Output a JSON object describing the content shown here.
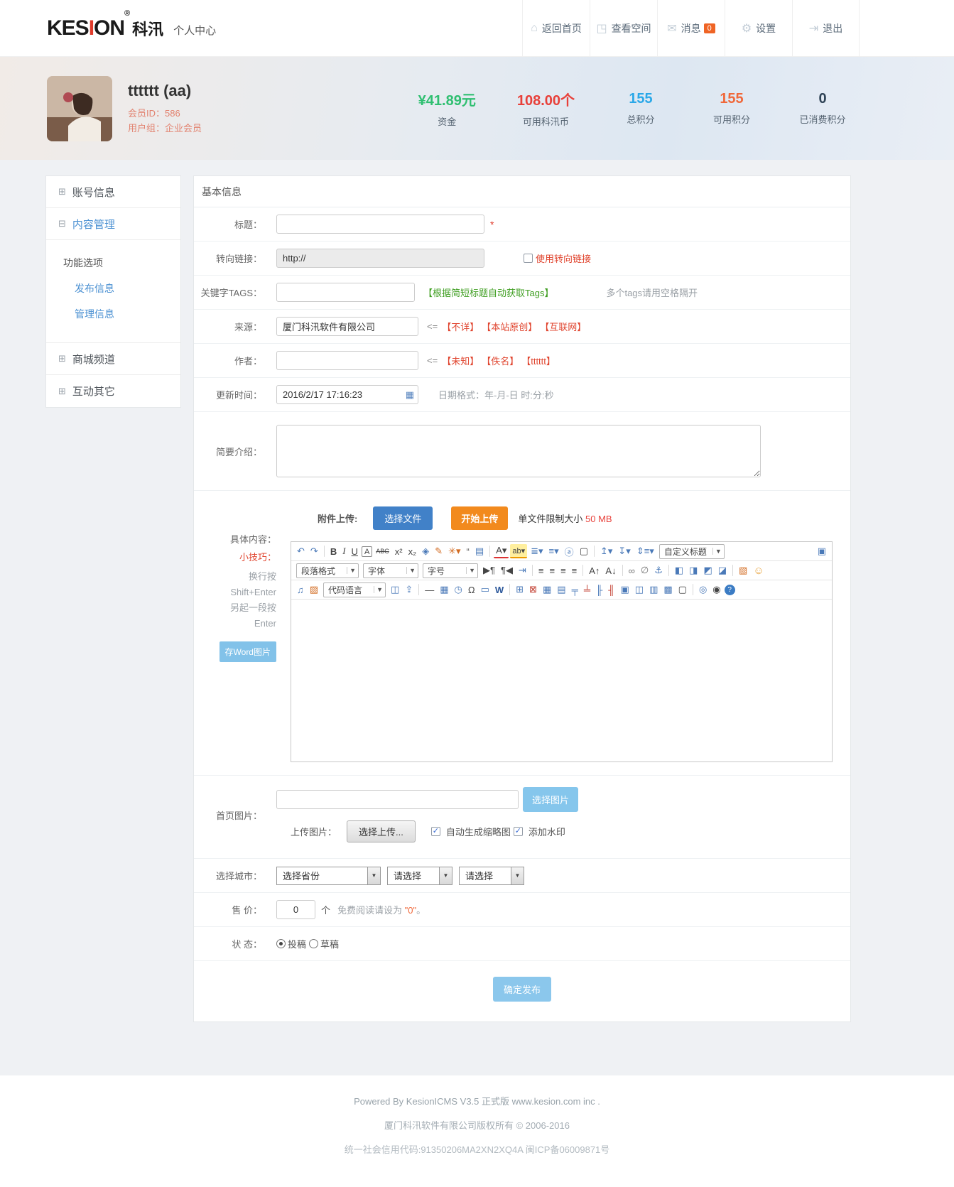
{
  "header": {
    "logo": {
      "left": "KES",
      "i": "I",
      "right": "ON",
      "reg": "®",
      "cn": "科汛",
      "subtitle": "个人中心"
    },
    "nav": [
      {
        "name": "nav-back-home",
        "icon": "home-icon",
        "glyph": "⌂",
        "label": "返回首页"
      },
      {
        "name": "nav-view-space",
        "icon": "space-icon",
        "glyph": "◳",
        "label": "查看空间"
      },
      {
        "name": "nav-messages",
        "icon": "message-icon",
        "glyph": "✉",
        "label": "消息",
        "badge": "0"
      },
      {
        "name": "nav-settings",
        "icon": "gear-icon",
        "glyph": "⚙",
        "label": "设置"
      },
      {
        "name": "nav-logout",
        "icon": "logout-icon",
        "glyph": "⇥",
        "label": "退出"
      }
    ]
  },
  "user": {
    "name": "tttttt (aa)",
    "member_id": "会员ID：586",
    "group": "用户组：企业会员",
    "stats": [
      {
        "name": "stat-funds",
        "value": "¥41.89元",
        "label": "资金",
        "cls": "green",
        "color": "#2fbf71"
      },
      {
        "name": "stat-coins",
        "value": "108.00个",
        "label": "可用科汛币",
        "cls": "red",
        "color": "#e8403a"
      },
      {
        "name": "stat-total-points",
        "value": "155",
        "label": "总积分",
        "cls": "blue",
        "color": "#2aa8e8"
      },
      {
        "name": "stat-usable-points",
        "value": "155",
        "label": "可用积分",
        "cls": "orange",
        "color": "#f0683a"
      },
      {
        "name": "stat-spent-points",
        "value": "0",
        "label": "已消费积分",
        "cls": "darkc",
        "color": "#2f4356"
      }
    ]
  },
  "sidebar": {
    "items": [
      {
        "label": "账号信息",
        "icon": "⊞"
      },
      {
        "label": "内容管理",
        "icon": "⊟"
      },
      {
        "label": "商城频道",
        "icon": "⊞"
      },
      {
        "label": "互动其它",
        "icon": "⊞"
      }
    ],
    "submenu": {
      "header": "功能选项",
      "links": [
        "发布信息",
        "管理信息"
      ]
    }
  },
  "form": {
    "section_title": "基本信息",
    "title": {
      "label": "标题：",
      "required": "*"
    },
    "redirect": {
      "label": "转向链接：",
      "value": "http://",
      "checkbox_label": "使用转向链接"
    },
    "tags": {
      "label": "关键字TAGS：",
      "auto_link": "【根据简短标题自动获取Tags】",
      "note": "多个tags请用空格隔开"
    },
    "source": {
      "label": "来源：",
      "value": "厦门科汛软件有限公司",
      "arrow": "<=",
      "options": [
        "【不详】",
        "【本站原创】",
        "【互联网】"
      ]
    },
    "author": {
      "label": "作者：",
      "arrow": "<=",
      "options": [
        "【未知】",
        "【佚名】",
        "【tttttt】"
      ]
    },
    "time": {
      "label": "更新时间：",
      "value": "2016/2/17 17:16:23",
      "note": "日期格式：年-月-日 时:分:秒"
    },
    "intro": {
      "label": "简要介绍："
    },
    "attach": {
      "label": "附件上传:",
      "choose_btn": "选择文件",
      "upload_btn": "开始上传",
      "note_prefix": "单文件限制大小",
      "note_size": "50 MB"
    },
    "content": {
      "label": "具体内容：",
      "tip_label": "小技巧：",
      "tips": [
        "换行按",
        "Shift+Enter",
        "另起一段按",
        "Enter"
      ],
      "word_btn": "存Word图片"
    },
    "homeimg": {
      "label": "首页图片：",
      "pick_btn": "选择图片",
      "upload_label": "上传图片：",
      "upload_btn": "选择上传...",
      "cb_thumb": "自动生成缩略图",
      "cb_watermark": "添加水印"
    },
    "city": {
      "label": "选择城市：",
      "selects": [
        "选择省份",
        "请选择",
        "请选择"
      ]
    },
    "price": {
      "label": "售 价：",
      "value": "0",
      "unit": "个",
      "note_prefix": "免费阅读请设为",
      "note_value": "\"0\"",
      "note_suffix": "。"
    },
    "status": {
      "label": "状 态：",
      "option1": "投稿",
      "option2": "草稿"
    },
    "submit_btn": "确定发布"
  },
  "editor": {
    "selects": {
      "custom_title": "自定义标题",
      "paragraph": "段落格式",
      "font": "字体",
      "size": "字号",
      "code": "代码语言"
    },
    "row1a": [
      {
        "n": "undo-icon",
        "g": "↶",
        "c": "blue"
      },
      {
        "n": "redo-icon",
        "g": "↷",
        "c": "blue"
      },
      {
        "c": "sep"
      },
      {
        "n": "bold-icon",
        "g": "B",
        "c": "boldg"
      },
      {
        "n": "italic-icon",
        "g": "I",
        "c": "italg"
      },
      {
        "n": "underline-icon",
        "g": "U",
        "c": "undg"
      },
      {
        "n": "font-style-icon",
        "g": "A",
        "c": "boxed"
      },
      {
        "n": "strikethrough-icon",
        "g": "ABC",
        "c": "strike"
      },
      {
        "n": "superscript-icon",
        "g": "x²"
      },
      {
        "n": "subscript-icon",
        "g": "x₂"
      },
      {
        "n": "eraser-icon",
        "g": "◈",
        "c": "blue"
      },
      {
        "n": "format-brush-icon",
        "g": "✎",
        "c": "orange"
      },
      {
        "n": "clear-format-icon",
        "g": "✳▾",
        "c": "orange"
      },
      {
        "n": "blockquote-icon",
        "g": "“",
        "c": "dark"
      },
      {
        "n": "paste-text-icon",
        "g": "▤",
        "c": "blue"
      },
      {
        "c": "sep"
      },
      {
        "n": "font-color-icon",
        "g": "A▾",
        "c": "fc"
      },
      {
        "n": "highlight-color-icon",
        "g": "ab▾",
        "c": "hl"
      },
      {
        "n": "ordered-list-icon",
        "g": "≣▾",
        "c": "blue"
      },
      {
        "n": "unordered-list-icon",
        "g": "≡▾",
        "c": "blue"
      },
      {
        "n": "anchor-name-icon",
        "g": "ⓐ",
        "c": "blue"
      },
      {
        "n": "new-document-icon",
        "g": "▢"
      },
      {
        "c": "sep"
      },
      {
        "n": "indent-icon",
        "g": "↥▾",
        "c": "blue"
      },
      {
        "n": "outdent-icon",
        "g": "↧▾",
        "c": "blue"
      },
      {
        "n": "line-height-icon",
        "g": "⇕≡▾",
        "c": "blue"
      }
    ],
    "row1b": [
      {
        "n": "fullscreen-icon",
        "g": "▣",
        "c": "blue"
      }
    ],
    "row2": [
      {
        "n": "ltr-paragraph-icon",
        "g": "▶¶"
      },
      {
        "n": "rtl-paragraph-icon",
        "g": "¶◀"
      },
      {
        "n": "first-indent-icon",
        "g": "⇥",
        "c": "blue"
      },
      {
        "c": "sep"
      },
      {
        "n": "align-left-icon",
        "g": "≡"
      },
      {
        "n": "align-center-icon",
        "g": "≡"
      },
      {
        "n": "align-right-icon",
        "g": "≡"
      },
      {
        "n": "align-justify-icon",
        "g": "≡"
      },
      {
        "c": "sep"
      },
      {
        "n": "font-bigger-icon",
        "g": "A↑"
      },
      {
        "n": "font-smaller-icon",
        "g": "A↓"
      },
      {
        "c": "sep"
      },
      {
        "n": "link-icon",
        "g": "∞",
        "c": "gray"
      },
      {
        "n": "unlink-icon",
        "g": "∅",
        "c": "gray"
      },
      {
        "n": "anchor-icon",
        "g": "⚓",
        "c": "blue"
      },
      {
        "c": "sep"
      },
      {
        "n": "float-left-icon",
        "g": "◧",
        "c": "blue"
      },
      {
        "n": "float-right-icon",
        "g": "◨",
        "c": "blue"
      },
      {
        "n": "image-left-icon",
        "g": "◩",
        "c": "blue"
      },
      {
        "n": "image-right-icon",
        "g": "◪",
        "c": "blue"
      },
      {
        "c": "sep"
      },
      {
        "n": "insert-image-icon",
        "g": "▧",
        "c": "orange"
      },
      {
        "n": "emoticon-icon",
        "g": "☺",
        "c": "smile"
      }
    ],
    "row3a": [
      {
        "n": "music-icon",
        "g": "♫",
        "c": "blue"
      },
      {
        "n": "media-icon",
        "g": "▨",
        "c": "orange"
      }
    ],
    "row3b": [
      {
        "n": "layout-column-icon",
        "g": "◫",
        "c": "blue"
      },
      {
        "n": "word-upload-icon",
        "g": "⇪",
        "c": "blue"
      },
      {
        "c": "sep"
      },
      {
        "n": "horizontal-rule-icon",
        "g": "—"
      },
      {
        "n": "calendar-insert-icon",
        "g": "▦",
        "c": "blue"
      },
      {
        "n": "clock-icon",
        "g": "◷",
        "c": "blue"
      },
      {
        "n": "special-char-icon",
        "g": "Ω"
      },
      {
        "n": "screenshot-icon",
        "g": "▭",
        "c": "blue"
      },
      {
        "n": "word-paste-icon",
        "g": "W",
        "c": "wordblue"
      },
      {
        "c": "sep"
      },
      {
        "n": "insert-table-icon",
        "g": "⊞",
        "c": "blue"
      },
      {
        "n": "delete-table-icon",
        "g": "⊠",
        "c": "tblred"
      },
      {
        "n": "table-props-icon",
        "g": "▦",
        "c": "blue"
      },
      {
        "n": "row-props-icon",
        "g": "▤",
        "c": "blue"
      },
      {
        "n": "insert-row-icon",
        "g": "╤",
        "c": "blue"
      },
      {
        "n": "delete-row-icon",
        "g": "╧",
        "c": "tblred"
      },
      {
        "n": "insert-col-icon",
        "g": "╟",
        "c": "blue"
      },
      {
        "n": "delete-col-icon",
        "g": "╢",
        "c": "tblred"
      },
      {
        "n": "merge-cells-icon",
        "g": "▣",
        "c": "blue"
      },
      {
        "n": "split-cell-icon",
        "g": "◫",
        "c": "blue"
      },
      {
        "n": "table-header-icon",
        "g": "▥",
        "c": "blue"
      },
      {
        "n": "table-border-icon",
        "g": "▩",
        "c": "blue"
      },
      {
        "n": "page-break-icon",
        "g": "▢"
      },
      {
        "c": "sep"
      },
      {
        "n": "preview-icon",
        "g": "◎",
        "c": "blue"
      },
      {
        "n": "find-replace-icon",
        "g": "◉"
      },
      {
        "n": "help-icon",
        "g": "?",
        "c": "helpblue"
      }
    ]
  },
  "footer": {
    "line1": "Powered By KesionICMS V3.5 正式版 www.kesion.com inc .",
    "line2": "厦门科汛软件有限公司版权所有 © 2006-2016",
    "line3": "统一社会信用代码:91350206MA2XN2XQ4A 闽ICP备06009871号"
  },
  "colors": {
    "accent_blue": "#4a90d2",
    "badge_orange": "#ef6425",
    "link_red": "#e0442e",
    "green_link": "#3f9e21",
    "btn_blue": "#4181c8",
    "btn_orange": "#f28a1d",
    "btn_light_blue": "#8bc7ec",
    "stat_green": "#2fbf71",
    "stat_red": "#e8403a",
    "stat_blue": "#2aa8e8",
    "stat_orange": "#f0683a"
  }
}
